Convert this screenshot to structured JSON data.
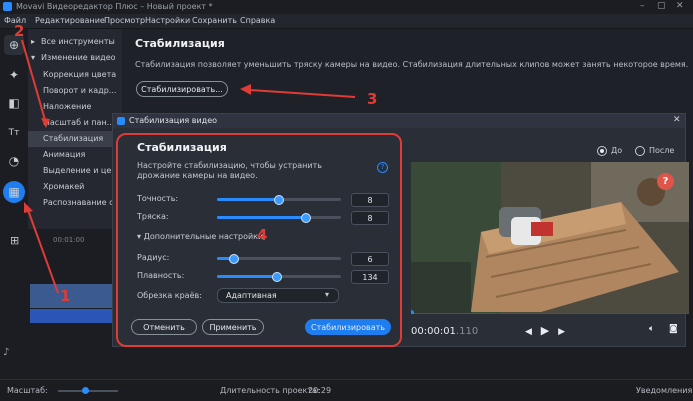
{
  "app": {
    "title": "Movavi Видеоредактор Плюс – Новый проект *"
  },
  "menu": [
    "Файл",
    "Редактирование",
    "Просмотр",
    "Настройки",
    "Сохранить",
    "Справка"
  ],
  "tools": {
    "all_label": "Все инструменты",
    "section_label": "Изменение видео",
    "items": [
      "Коррекция цвета",
      "Поворот и кадр...",
      "Наложение",
      "Масштаб и пан...",
      "Стабилизация",
      "Анимация",
      "Выделение и цензура",
      "Хромакей",
      "Распознавание с..."
    ],
    "selected": "Стабилизация"
  },
  "panel": {
    "title": "Стабилизация",
    "description": "Стабилизация позволяет уменьшить тряску камеры на видео. Стабилизация длительных клипов может занять некоторое время.",
    "stabilize_button": "Стабилизировать..."
  },
  "timeline": {
    "time": "00:01:00"
  },
  "status": {
    "zoom_label": "Масштаб:",
    "duration_label": "Длительность проекта:",
    "duration_value": "20:29",
    "notifications": "Уведомления"
  },
  "dialog": {
    "window_title": "Стабилизация видео",
    "heading": "Стабилизация",
    "hint": "Настройте стабилизацию, чтобы устранить дрожание камеры на видео.",
    "accuracy_label": "Точность:",
    "accuracy_value": "8",
    "accuracy_level": 0.5,
    "shake_label": "Тряска:",
    "shake_value": "8",
    "shake_level": 0.72,
    "advanced_label": "Дополнительные настройки",
    "radius_label": "Радиус:",
    "radius_value": "6",
    "radius_level": 0.14,
    "smoothness_label": "Плавность:",
    "smoothness_value": "134",
    "smoothness_level": 0.48,
    "crop_label": "Обрезка краёв:",
    "crop_value": "Адаптивная",
    "cancel": "Отменить",
    "apply": "Применить",
    "stabilize": "Стабилизировать",
    "before_label": "До",
    "after_label": "После",
    "timecode": "00:00:01",
    "timecode_frac": ".110"
  },
  "annotations": [
    "1",
    "2",
    "3",
    "4"
  ],
  "colors": {
    "accent": "#2a8bff",
    "annotation": "#e03b35",
    "help": "#e0544a"
  },
  "icons": [
    "movavi-logo-icon",
    "import-icon",
    "magic-wand-icon",
    "transition-icon",
    "titles-icon",
    "clock-icon",
    "more-tools-icon",
    "help-icon",
    "close-icon",
    "play-icon",
    "fullscreen-icon",
    "volume-icon",
    "snapshot-icon"
  ]
}
